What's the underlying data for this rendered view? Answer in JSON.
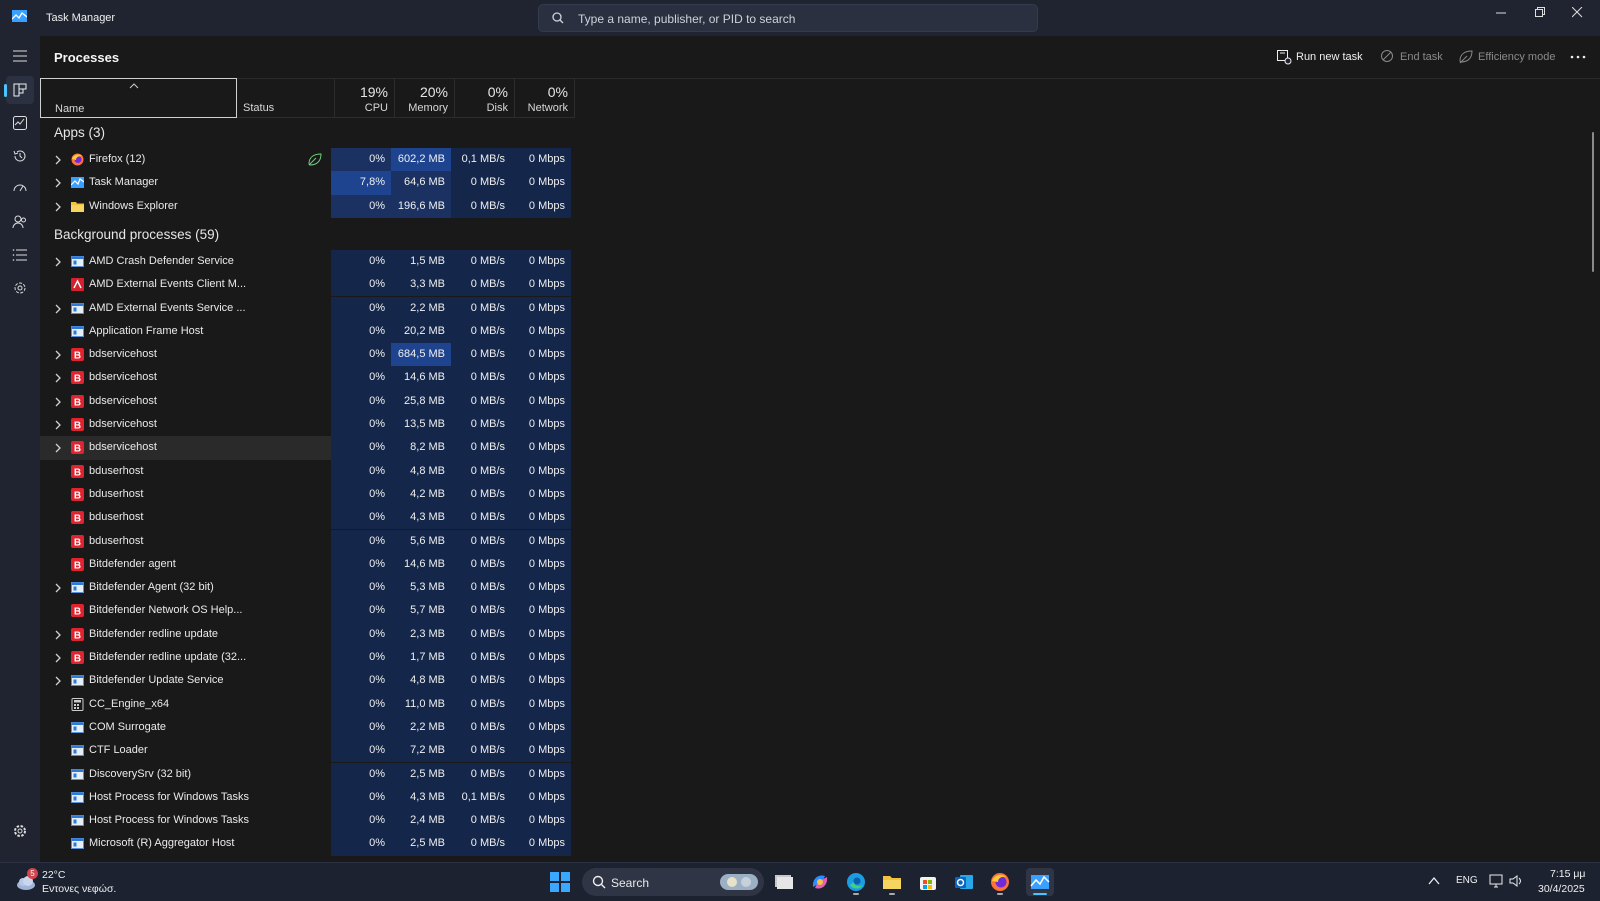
{
  "window": {
    "title": "Task Manager",
    "search_placeholder": "Type a name, publisher, or PID to search"
  },
  "toolbar": {
    "page_title": "Processes",
    "run_new_task": "Run new task",
    "end_task": "End task",
    "efficiency_mode": "Efficiency mode"
  },
  "columns": {
    "name": "Name",
    "status": "Status",
    "cpu_pct": "19%",
    "cpu": "CPU",
    "memory_pct": "20%",
    "memory": "Memory",
    "disk_pct": "0%",
    "disk": "Disk",
    "network_pct": "0%",
    "network": "Network"
  },
  "sections": {
    "apps": "Apps (3)",
    "background": "Background processes (59)"
  },
  "apps": [
    {
      "name": "Firefox (12)",
      "icon": "firefox",
      "expand": true,
      "eco": true,
      "cpu": "0%",
      "mem": "602,2 MB",
      "disk": "0,1 MB/s",
      "net": "0 Mbps",
      "hl_cpu": 1,
      "hl_mem": 2
    },
    {
      "name": "Task Manager",
      "icon": "taskmgr",
      "expand": true,
      "eco": false,
      "cpu": "7,8%",
      "mem": "64,6 MB",
      "disk": "0 MB/s",
      "net": "0 Mbps",
      "hl_cpu": 2,
      "hl_mem": 1
    },
    {
      "name": "Windows Explorer",
      "icon": "folder",
      "expand": true,
      "eco": false,
      "cpu": "0%",
      "mem": "196,6 MB",
      "disk": "0 MB/s",
      "net": "0 Mbps",
      "hl_cpu": 1,
      "hl_mem": 1
    }
  ],
  "background": [
    {
      "name": "AMD Crash Defender Service",
      "icon": "window",
      "expand": true,
      "cpu": "0%",
      "mem": "1,5 MB",
      "disk": "0 MB/s",
      "net": "0 Mbps",
      "hl_mem": 0
    },
    {
      "name": "AMD External Events Client M...",
      "icon": "amd",
      "expand": false,
      "cpu": "0%",
      "mem": "3,3 MB",
      "disk": "0 MB/s",
      "net": "0 Mbps",
      "hl_mem": 0
    },
    {
      "name": "AMD External Events Service ...",
      "icon": "window",
      "expand": true,
      "cpu": "0%",
      "mem": "2,2 MB",
      "disk": "0 MB/s",
      "net": "0 Mbps",
      "hl_mem": 0
    },
    {
      "name": "Application Frame Host",
      "icon": "window",
      "expand": false,
      "cpu": "0%",
      "mem": "20,2 MB",
      "disk": "0 MB/s",
      "net": "0 Mbps",
      "hl_mem": 0
    },
    {
      "name": "bdservicehost",
      "icon": "bd",
      "expand": true,
      "cpu": "0%",
      "mem": "684,5 MB",
      "disk": "0 MB/s",
      "net": "0 Mbps",
      "hl_mem": 2
    },
    {
      "name": "bdservicehost",
      "icon": "bd",
      "expand": true,
      "cpu": "0%",
      "mem": "14,6 MB",
      "disk": "0 MB/s",
      "net": "0 Mbps",
      "hl_mem": 0
    },
    {
      "name": "bdservicehost",
      "icon": "bd",
      "expand": true,
      "cpu": "0%",
      "mem": "25,8 MB",
      "disk": "0 MB/s",
      "net": "0 Mbps",
      "hl_mem": 0
    },
    {
      "name": "bdservicehost",
      "icon": "bd",
      "expand": true,
      "cpu": "0%",
      "mem": "13,5 MB",
      "disk": "0 MB/s",
      "net": "0 Mbps",
      "hl_mem": 0
    },
    {
      "name": "bdservicehost",
      "icon": "bd",
      "expand": true,
      "cpu": "0%",
      "mem": "8,2 MB",
      "disk": "0 MB/s",
      "net": "0 Mbps",
      "hl_mem": 0,
      "selected": true
    },
    {
      "name": "bduserhost",
      "icon": "bd",
      "expand": false,
      "cpu": "0%",
      "mem": "4,8 MB",
      "disk": "0 MB/s",
      "net": "0 Mbps",
      "hl_mem": 0
    },
    {
      "name": "bduserhost",
      "icon": "bd",
      "expand": false,
      "cpu": "0%",
      "mem": "4,2 MB",
      "disk": "0 MB/s",
      "net": "0 Mbps",
      "hl_mem": 0
    },
    {
      "name": "bduserhost",
      "icon": "bd",
      "expand": false,
      "cpu": "0%",
      "mem": "4,3 MB",
      "disk": "0 MB/s",
      "net": "0 Mbps",
      "hl_mem": 0
    },
    {
      "name": "bduserhost",
      "icon": "bd",
      "expand": false,
      "cpu": "0%",
      "mem": "5,6 MB",
      "disk": "0 MB/s",
      "net": "0 Mbps",
      "hl_mem": 0
    },
    {
      "name": "Bitdefender agent",
      "icon": "bd",
      "expand": false,
      "cpu": "0%",
      "mem": "14,6 MB",
      "disk": "0 MB/s",
      "net": "0 Mbps",
      "hl_mem": 0
    },
    {
      "name": "Bitdefender Agent (32 bit)",
      "icon": "window",
      "expand": true,
      "cpu": "0%",
      "mem": "5,3 MB",
      "disk": "0 MB/s",
      "net": "0 Mbps",
      "hl_mem": 0
    },
    {
      "name": "Bitdefender Network OS Help...",
      "icon": "bd",
      "expand": false,
      "cpu": "0%",
      "mem": "5,7 MB",
      "disk": "0 MB/s",
      "net": "0 Mbps",
      "hl_mem": 0
    },
    {
      "name": "Bitdefender redline update",
      "icon": "bd",
      "expand": true,
      "cpu": "0%",
      "mem": "2,3 MB",
      "disk": "0 MB/s",
      "net": "0 Mbps",
      "hl_mem": 0
    },
    {
      "name": "Bitdefender redline update (32...",
      "icon": "bd",
      "expand": true,
      "cpu": "0%",
      "mem": "1,7 MB",
      "disk": "0 MB/s",
      "net": "0 Mbps",
      "hl_mem": 0
    },
    {
      "name": "Bitdefender Update Service",
      "icon": "window",
      "expand": true,
      "cpu": "0%",
      "mem": "4,8 MB",
      "disk": "0 MB/s",
      "net": "0 Mbps",
      "hl_mem": 0
    },
    {
      "name": "CC_Engine_x64",
      "icon": "calc",
      "expand": false,
      "cpu": "0%",
      "mem": "11,0 MB",
      "disk": "0 MB/s",
      "net": "0 Mbps",
      "hl_mem": 0
    },
    {
      "name": "COM Surrogate",
      "icon": "window",
      "expand": false,
      "cpu": "0%",
      "mem": "2,2 MB",
      "disk": "0 MB/s",
      "net": "0 Mbps",
      "hl_mem": 0
    },
    {
      "name": "CTF Loader",
      "icon": "window",
      "expand": false,
      "cpu": "0%",
      "mem": "7,2 MB",
      "disk": "0 MB/s",
      "net": "0 Mbps",
      "hl_mem": 0
    },
    {
      "name": "DiscoverySrv (32 bit)",
      "icon": "window",
      "expand": false,
      "cpu": "0%",
      "mem": "2,5 MB",
      "disk": "0 MB/s",
      "net": "0 Mbps",
      "hl_mem": 0
    },
    {
      "name": "Host Process for Windows Tasks",
      "icon": "window",
      "expand": false,
      "cpu": "0%",
      "mem": "4,3 MB",
      "disk": "0,1 MB/s",
      "net": "0 Mbps",
      "hl_mem": 0
    },
    {
      "name": "Host Process for Windows Tasks",
      "icon": "window",
      "expand": false,
      "cpu": "0%",
      "mem": "2,4 MB",
      "disk": "0 MB/s",
      "net": "0 Mbps",
      "hl_mem": 0
    },
    {
      "name": "Microsoft (R) Aggregator Host",
      "icon": "window",
      "expand": false,
      "cpu": "0%",
      "mem": "2,5 MB",
      "disk": "0 MB/s",
      "net": "0 Mbps",
      "hl_mem": 0
    }
  ],
  "taskbar": {
    "weather_temp": "22°C",
    "weather_desc": "Εντονες νεφώσ.",
    "weather_badge": "5",
    "search_label": "Search",
    "lang": "ENG",
    "time": "7:15 μμ",
    "date": "30/4/2025"
  },
  "colors": {
    "heat_0": "#14264a",
    "heat_1": "#1a3162",
    "heat_2": "#1f448f",
    "accent": "#4cc2ff"
  }
}
